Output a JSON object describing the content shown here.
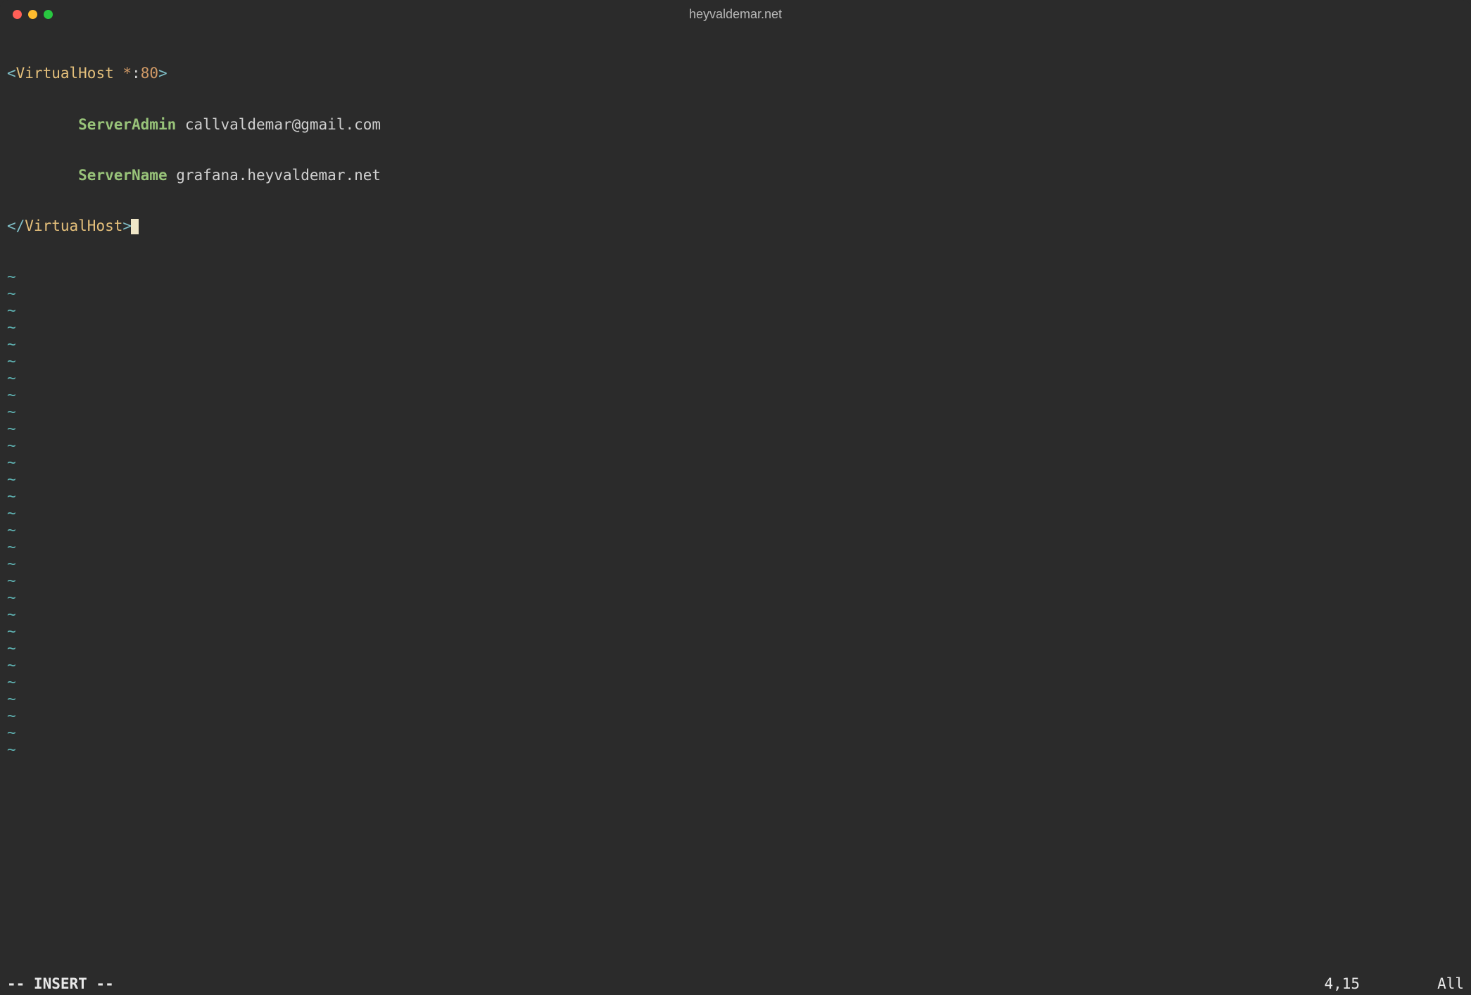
{
  "window": {
    "title": "heyvaldemar.net"
  },
  "editor": {
    "line1": {
      "open_angle": "<",
      "tag": "VirtualHost",
      "sep": " ",
      "star": "*",
      "colon": ":",
      "port": "80",
      "close_angle": ">"
    },
    "line2": {
      "indent": "        ",
      "directive": "ServerAdmin",
      "sep": " ",
      "value": "callvaldemar@gmail.com"
    },
    "line3": {
      "indent": "        ",
      "directive": "ServerName",
      "sep": " ",
      "value": "grafana.heyvaldemar.net"
    },
    "line4": {
      "open_angle": "</",
      "tag": "VirtualHost",
      "close_angle": ">"
    },
    "empty_marker": "~",
    "empty_count": 29
  },
  "status": {
    "mode": "-- INSERT --",
    "position": "4,15",
    "percent": "All"
  },
  "colors": {
    "bg": "#2b2b2b",
    "angle": "#7fbfc7",
    "tag": "#e5c07b",
    "star": "#d19a66",
    "attr": "#98c379",
    "text": "#d0d0d0"
  }
}
